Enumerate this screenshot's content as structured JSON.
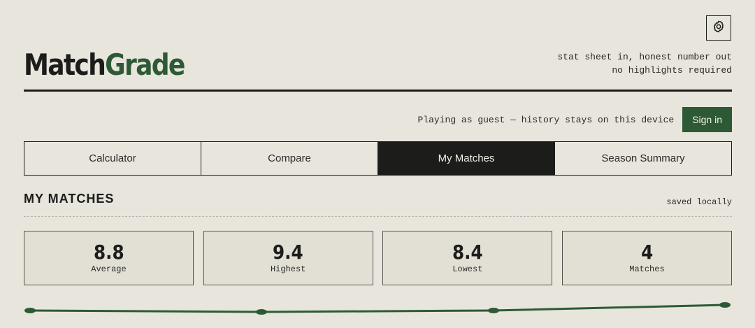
{
  "header": {
    "logo_part1": "Match",
    "logo_part2": "Grade",
    "tagline_line1": "stat sheet in, honest number out",
    "tagline_line2": "no highlights required",
    "settings_icon": "gear-icon"
  },
  "account": {
    "guest_text": "Playing as guest — history stays on this device",
    "sign_in_label": "Sign in"
  },
  "tabs": [
    {
      "label": "Calculator",
      "active": false
    },
    {
      "label": "Compare",
      "active": false
    },
    {
      "label": "My Matches",
      "active": true
    },
    {
      "label": "Season Summary",
      "active": false
    }
  ],
  "section": {
    "title": "MY MATCHES",
    "note": "saved locally"
  },
  "stats": [
    {
      "value": "8.8",
      "label": "Average"
    },
    {
      "value": "9.4",
      "label": "Highest"
    },
    {
      "value": "8.4",
      "label": "Lowest"
    },
    {
      "value": "4",
      "label": "Matches"
    }
  ],
  "colors": {
    "accent": "#2d5a35",
    "ink": "#1c1c1a",
    "background": "#e8e5dd"
  }
}
